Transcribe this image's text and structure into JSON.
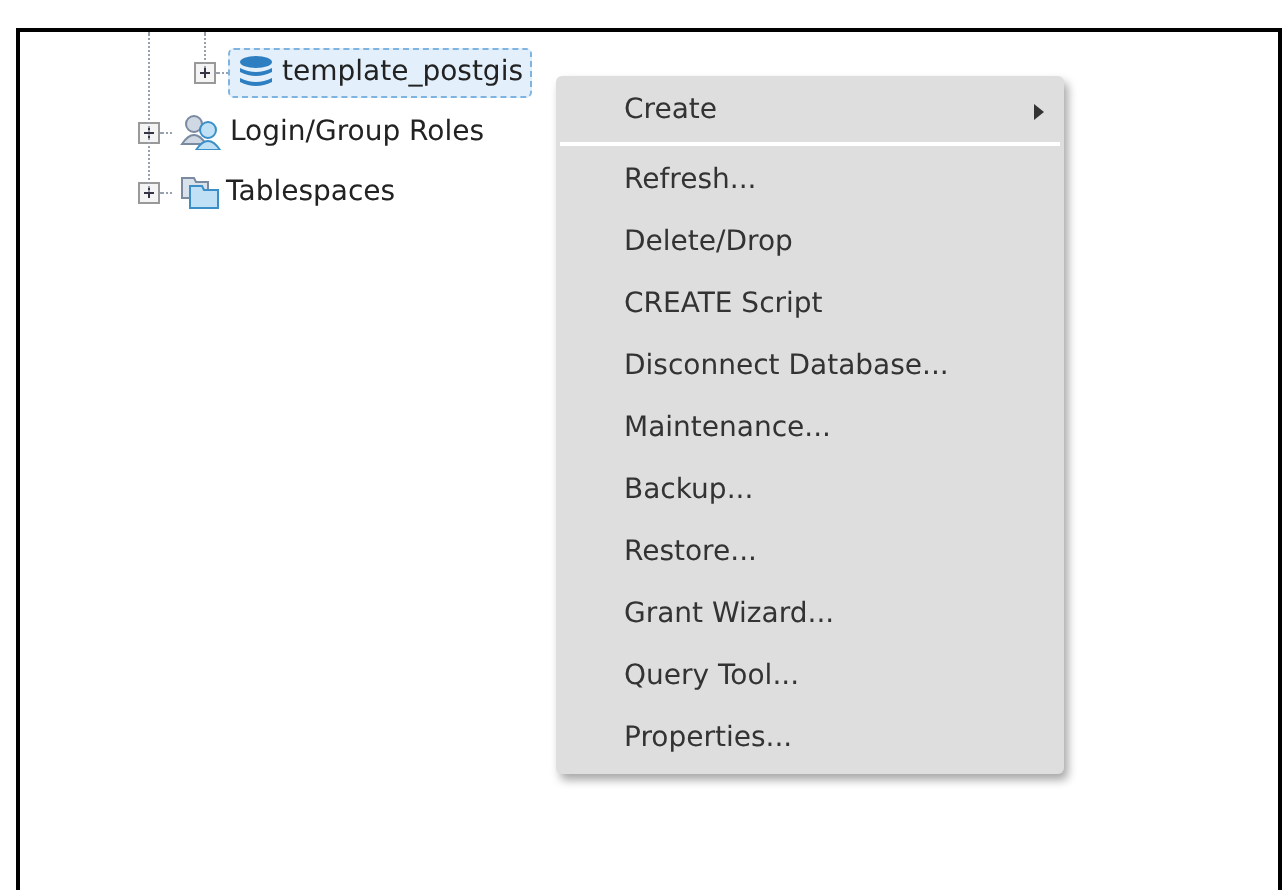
{
  "tree": {
    "items": [
      {
        "children": [
          {
            "label": "template_postgis",
            "kind": "database",
            "selected": true,
            "expanded": false
          }
        ]
      },
      {
        "label": "Login/Group Roles",
        "kind": "roles",
        "selected": false,
        "expanded": false
      },
      {
        "label": "Tablespaces",
        "kind": "tablespaces",
        "selected": false,
        "expanded": false
      }
    ]
  },
  "context_menu": {
    "items": [
      {
        "label": "Create",
        "has_submenu": true
      },
      {
        "label": "Refresh...",
        "has_submenu": false
      },
      {
        "label": "Delete/Drop",
        "has_submenu": false
      },
      {
        "label": "CREATE Script",
        "has_submenu": false
      },
      {
        "label": "Disconnect Database...",
        "has_submenu": false
      },
      {
        "label": "Maintenance...",
        "has_submenu": false
      },
      {
        "label": "Backup...",
        "has_submenu": false
      },
      {
        "label": "Restore...",
        "has_submenu": false
      },
      {
        "label": "Grant Wizard...",
        "has_submenu": false
      },
      {
        "label": "Query Tool...",
        "has_submenu": false
      },
      {
        "label": "Properties...",
        "has_submenu": false
      }
    ]
  }
}
